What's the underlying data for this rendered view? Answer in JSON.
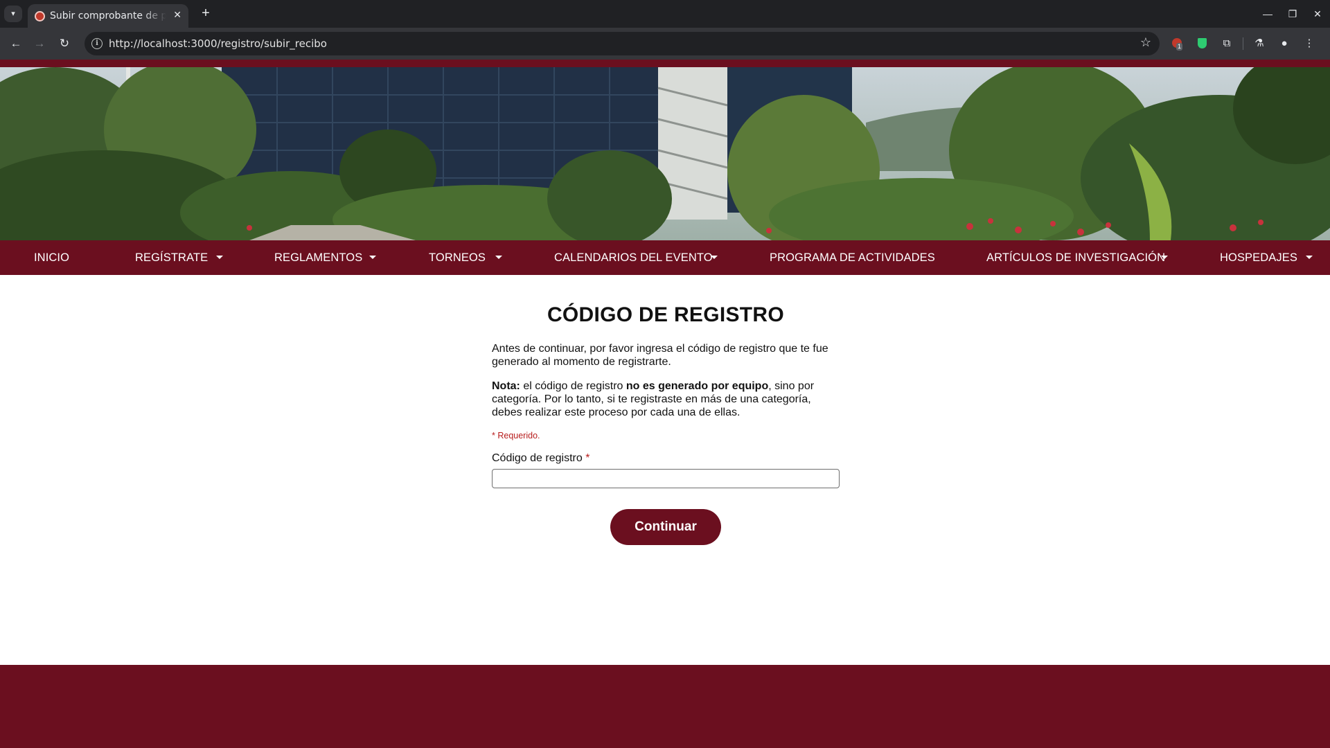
{
  "browser": {
    "tab_title": "Subir comprobante de pago",
    "url": "http://localhost:3000/registro/subir_recibo",
    "extension_badge": "1"
  },
  "nav": {
    "items": [
      {
        "label": "INICIO",
        "dropdown": false
      },
      {
        "label": "REGÍSTRATE",
        "dropdown": true
      },
      {
        "label": "REGLAMENTOS",
        "dropdown": true
      },
      {
        "label": "TORNEOS",
        "dropdown": true
      },
      {
        "label": "CALENDARIOS DEL EVENTO",
        "dropdown": true
      },
      {
        "label": "PROGRAMA DE ACTIVIDADES",
        "dropdown": false
      },
      {
        "label": "ARTÍCULOS DE INVESTIGACIÓN",
        "dropdown": true
      },
      {
        "label": "HOSPEDAJES",
        "dropdown": true
      }
    ]
  },
  "form": {
    "title": "CÓDIGO DE REGISTRO",
    "intro": "Antes de continuar, por favor ingresa el código de registro que te fue generado al momento de registrarte.",
    "note_label": "Nota:",
    "note_part1": " el código de registro ",
    "note_bold": "no es generado por equipo",
    "note_part2": ", sino por categoría. Por lo tanto, si te registraste en más de una categoría, debes realizar este proceso por cada una de ellas.",
    "required_hint": "* Requerido.",
    "field_label": "Código de registro",
    "field_required_mark": "*",
    "field_value": "",
    "submit_label": "Continuar"
  },
  "colors": {
    "brand": "#6b0f1f",
    "required": "#b71c1c"
  },
  "icons": [
    "tab-search-icon",
    "close-icon",
    "plus-icon",
    "back-icon",
    "forward-icon",
    "reload-icon",
    "info-icon",
    "star-icon",
    "extension-icon",
    "lab-icon",
    "profile-icon",
    "menu-icon",
    "caret-down-icon"
  ]
}
